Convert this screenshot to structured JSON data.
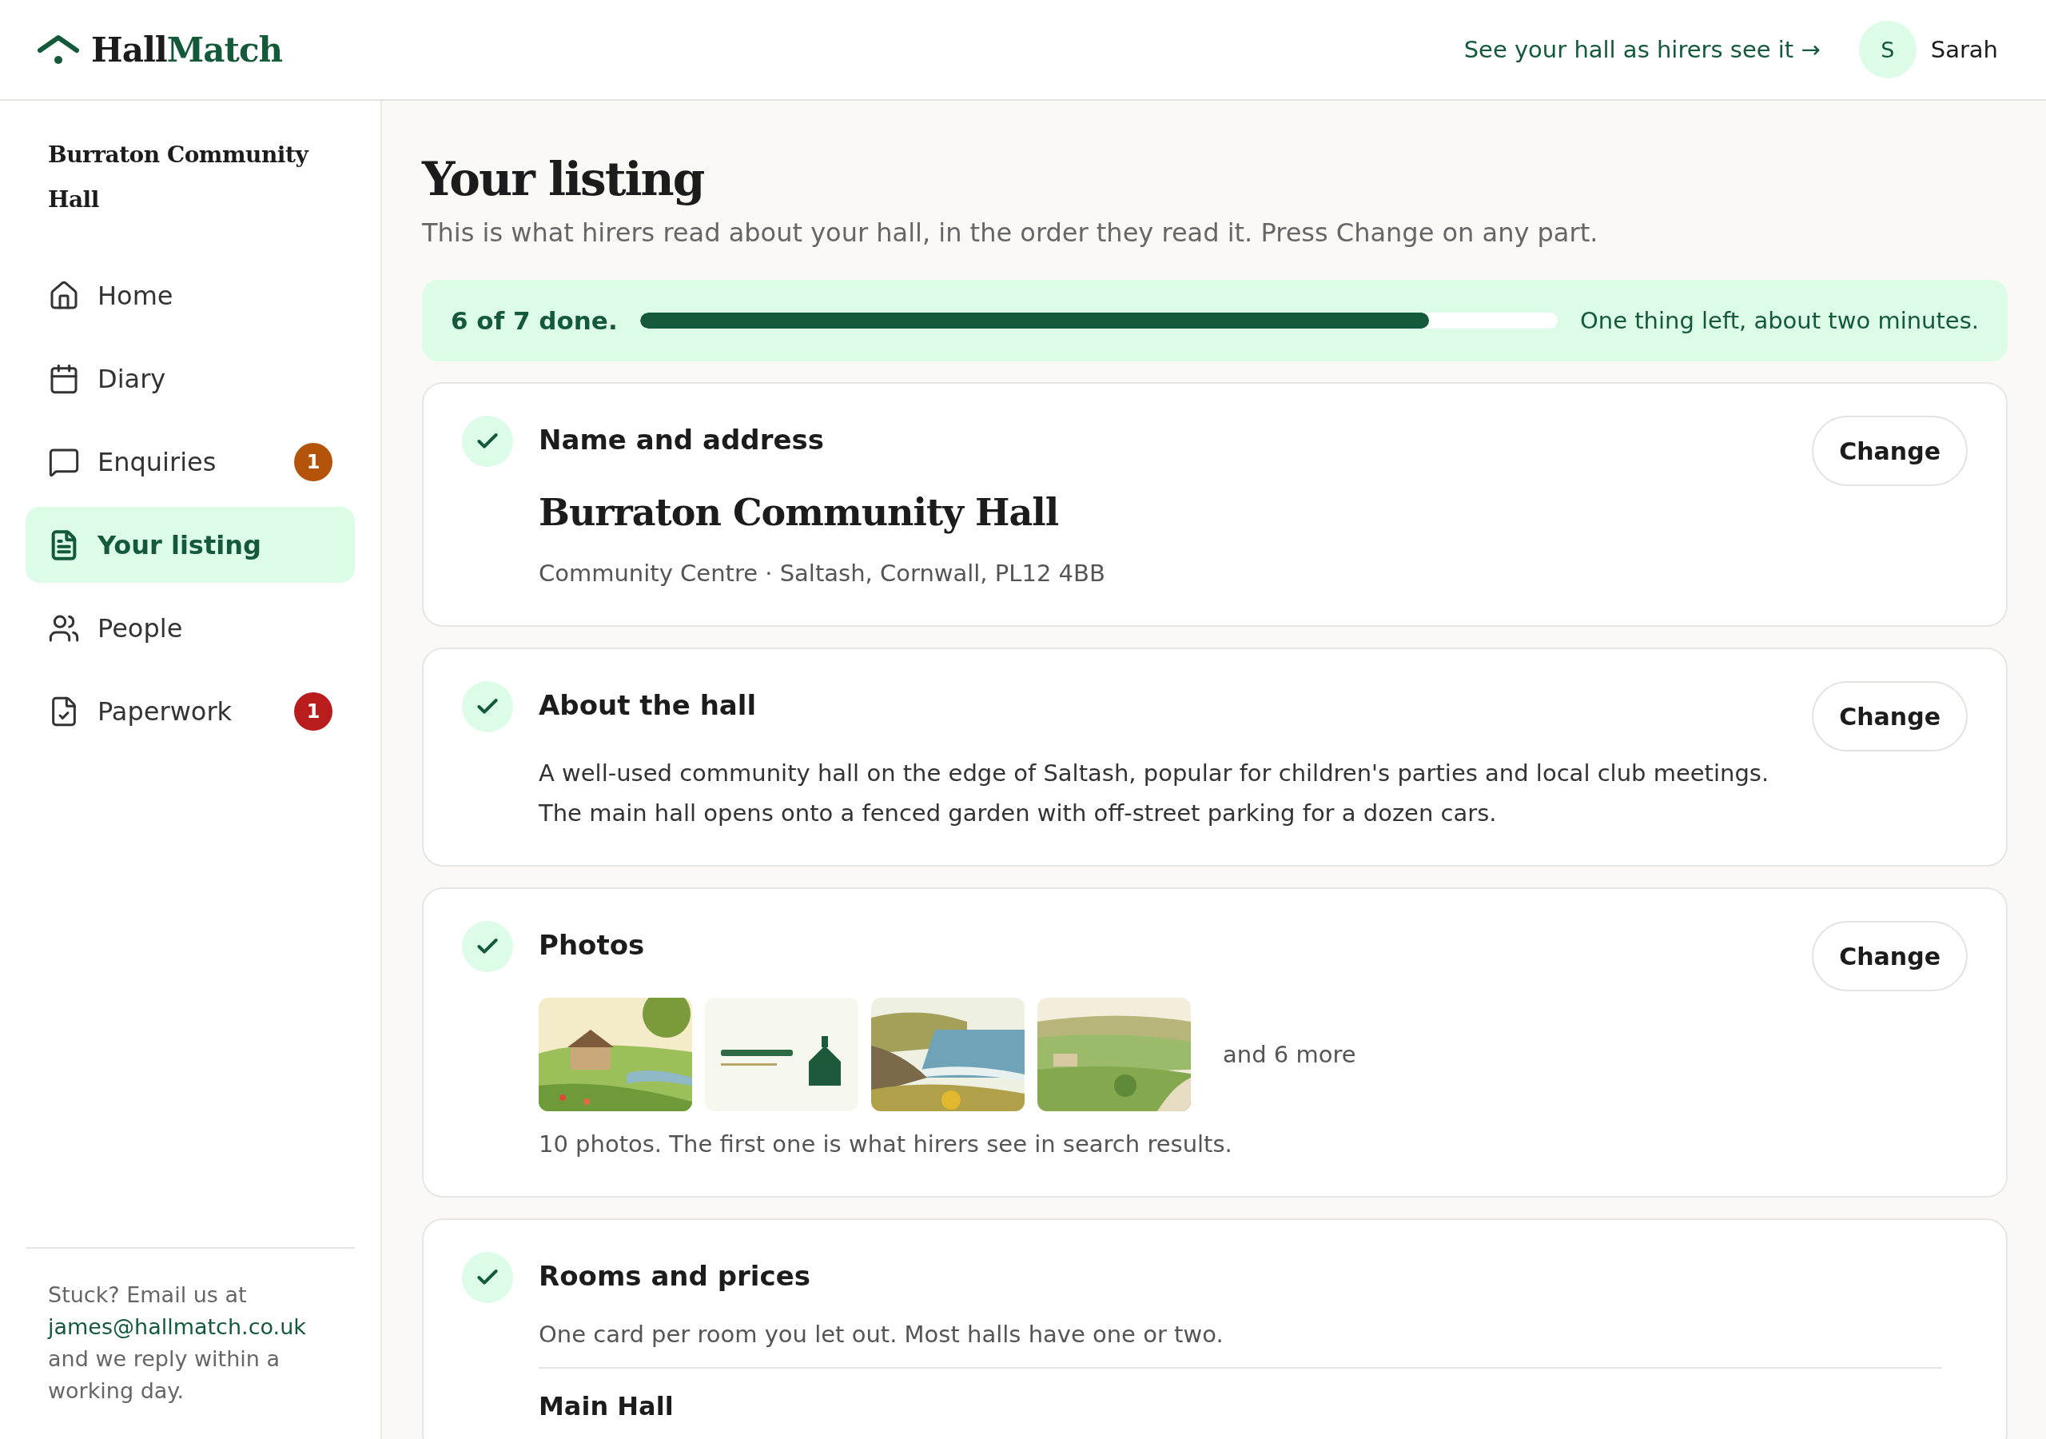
{
  "header": {
    "logo": {
      "first": "Hall",
      "second": "Match"
    },
    "preview_link": "See your hall as hirers see it →",
    "user": {
      "initial": "S",
      "name": "Sarah"
    }
  },
  "sidebar": {
    "hall_name": "Burraton Community Hall",
    "items": [
      {
        "label": "Home",
        "selected": false
      },
      {
        "label": "Diary",
        "selected": false
      },
      {
        "label": "Enquiries",
        "selected": false,
        "badge": "1",
        "color": "#b4530a"
      },
      {
        "label": "Your listing",
        "selected": true
      },
      {
        "label": "People",
        "selected": false
      },
      {
        "label": "Paperwork",
        "selected": false,
        "badge": "1",
        "color": "#b91c1c"
      }
    ],
    "help": {
      "before": "Stuck? Email us at",
      "email": "james@hallmatch.co.uk",
      "after": "and we reply within a working day."
    }
  },
  "page": {
    "title": "Your listing",
    "subtitle": "This is what hirers read about your hall, in the order they read it. Press Change on any part."
  },
  "progress": {
    "label": "6 of 7 done.",
    "level": 0.86,
    "note": "One thing left, about two minutes."
  },
  "sections": [
    {
      "kind": "address",
      "title": "Name and address",
      "done": true,
      "button": "Change",
      "name": "Burraton Community Hall",
      "details": "Community Centre · Saltash, Cornwall, PL12 4BB"
    },
    {
      "kind": "text",
      "title": "About the hall",
      "done": true,
      "button": "Change",
      "text": "A well-used community hall on the edge of Saltash, popular for children's parties and local club meetings. The main hall opens onto a fenced garden with off-street parking for a dozen cars."
    },
    {
      "kind": "photos",
      "title": "Photos",
      "done": true,
      "button": "Change",
      "more": "and 6 more",
      "caption": "10 photos. The first one is what hirers see in search results."
    },
    {
      "kind": "rooms",
      "title": "Rooms and prices",
      "done": true,
      "description": "One card per room you let out. Most halls have one or two.",
      "rooms": [
        {
          "name": "Main Hall"
        }
      ]
    }
  ]
}
